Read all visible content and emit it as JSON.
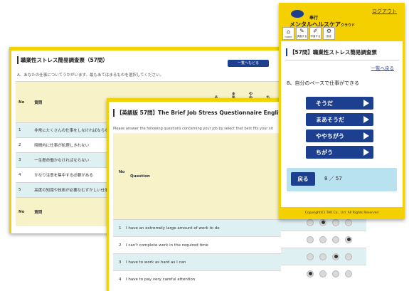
{
  "jp_window": {
    "title": "職業性ストレス簡易調査票（57問）",
    "list_button": "一覧へもどる",
    "instruction": "A．あなたの仕事についてうかがいます。最もあてはまるものを選択してください。",
    "col_no": "No",
    "col_question": "質問",
    "answer_cols": [
      "そうだ",
      "まあそうだ",
      "ややちがう",
      "ちがう"
    ],
    "rows": [
      {
        "no": "1",
        "text": "非常にたくさんの仕事をしなければならない"
      },
      {
        "no": "2",
        "text": "時間内に仕事が処理しきれない"
      },
      {
        "no": "3",
        "text": "一生懸命働かなければならない"
      },
      {
        "no": "4",
        "text": "かなり注意を集中する必要がある"
      },
      {
        "no": "5",
        "text": "高度の知識や技術が必要なむずかしい仕事だ"
      }
    ],
    "footer_no": "No",
    "footer_question": "質問"
  },
  "en_window": {
    "title": "【英語版 57問】The Brief Job Stress Questionnaire English",
    "instruction": "Please answer the following questions concerning your job by select that best fits your sit",
    "col_no": "No",
    "col_question": "Question",
    "rows": [
      {
        "no": "1",
        "text": "I have an extremely large amount of work to do",
        "selected": 1
      },
      {
        "no": "2",
        "text": "I can't complete work in the required time",
        "selected": 3
      },
      {
        "no": "3",
        "text": "I have to work as hard as I can",
        "selected": 2
      },
      {
        "no": "4",
        "text": "I have to pay very careful attention",
        "selected": 0
      }
    ]
  },
  "mobile": {
    "logout": "ログアウト",
    "logo_sub": "奉行",
    "logo_main": "メンタルヘルスケア",
    "logo_suffix": "クラウド",
    "nav": [
      {
        "label": "home",
        "glyph": "⌂"
      },
      {
        "label": "調査する",
        "glyph": "✎"
      },
      {
        "label": "学習する",
        "glyph": "✐"
      },
      {
        "label": "設定",
        "glyph": "⚙"
      }
    ],
    "title": "【57問】職業性ストレス簡易調査票",
    "back_to_list": "一覧へ戻る",
    "question": "8、自分のペースで仕事ができる",
    "answers": [
      "そうだ",
      "まあそうだ",
      "ややちがう",
      "ちがう"
    ],
    "back_button": "戻る",
    "progress": "8 ／ 57",
    "copyright": "Copyright(C) TAK Co., Ltd. All Rights Reserved"
  }
}
